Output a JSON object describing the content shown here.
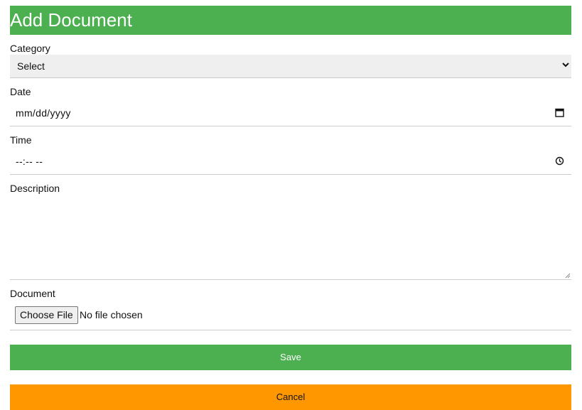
{
  "form": {
    "title": "Add Document",
    "category": {
      "label": "Category",
      "selected": "Select"
    },
    "date": {
      "label": "Date",
      "placeholder": "mm/dd/yyyy"
    },
    "time": {
      "label": "Time",
      "placeholder": "--:-- --"
    },
    "description": {
      "label": "Description"
    },
    "document": {
      "label": "Document",
      "button": "Choose File",
      "status": "No file chosen"
    },
    "save_label": "Save",
    "cancel_label": "Cancel"
  },
  "colors": {
    "header": "#4caf50",
    "save": "#4caf50",
    "cancel": "#ff9800"
  },
  "icons": {
    "date": "calendar-icon",
    "time": "clock-icon",
    "select": "chevron-down-icon"
  }
}
